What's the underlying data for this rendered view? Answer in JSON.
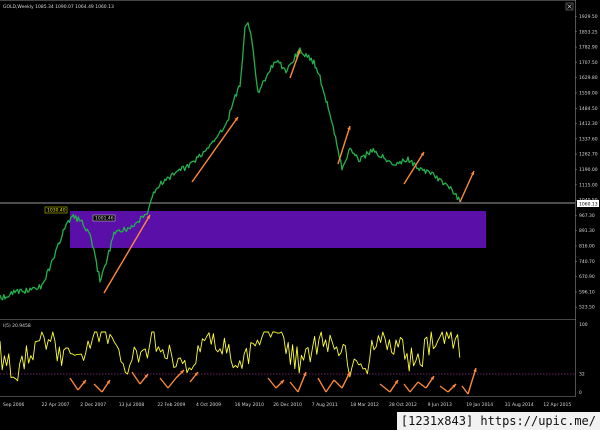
{
  "header": {
    "symbol_line": "GOLD,Weekly  1085.34 1090.07 1064.49 1060.13",
    "close_icon": "close-icon"
  },
  "main_chart": {
    "y_labels": [
      "1929.50",
      "1853.25",
      "1782.90",
      "1707.50",
      "1629.80",
      "1559.00",
      "1484.50",
      "1412.30",
      "1337.60",
      "1262.70",
      "1190.00",
      "1115.00",
      "1040.50",
      "967.30",
      "891.30",
      "816.00",
      "740.70",
      "670.90",
      "596.10",
      "523.50"
    ],
    "current_price": "1060.13",
    "box_label_left": "1030.40",
    "box_label_right": "1001.46",
    "colors": {
      "price": "#22b14c",
      "zone": "#5a0fa8",
      "trend_arrows": "#ff8a3d",
      "crosshair": "#d0d0d0"
    }
  },
  "indicator": {
    "header": "I(5) 20.9458",
    "y_labels": [
      "100",
      "32",
      "0"
    ],
    "colors": {
      "line": "#ffff33",
      "arrows": "#ff8a3d",
      "level_32": "#ff55ff"
    }
  },
  "x_axis": {
    "labels": [
      "Sep 2006",
      "22 Apr 2007",
      "2 Dec 2007",
      "13 Jul 2008",
      "22 Feb 2009",
      "4 Oct 2009",
      "16 May 2010",
      "26 Dec 2010",
      "7 Aug 2011",
      "18 Mar 2012",
      "28 Oct 2012",
      "9 Jun 2013",
      "19 Jan 2014",
      "31 Aug 2014",
      "12 Apr 2015"
    ]
  },
  "watermark": "[1231x843] https://upic.me/"
}
